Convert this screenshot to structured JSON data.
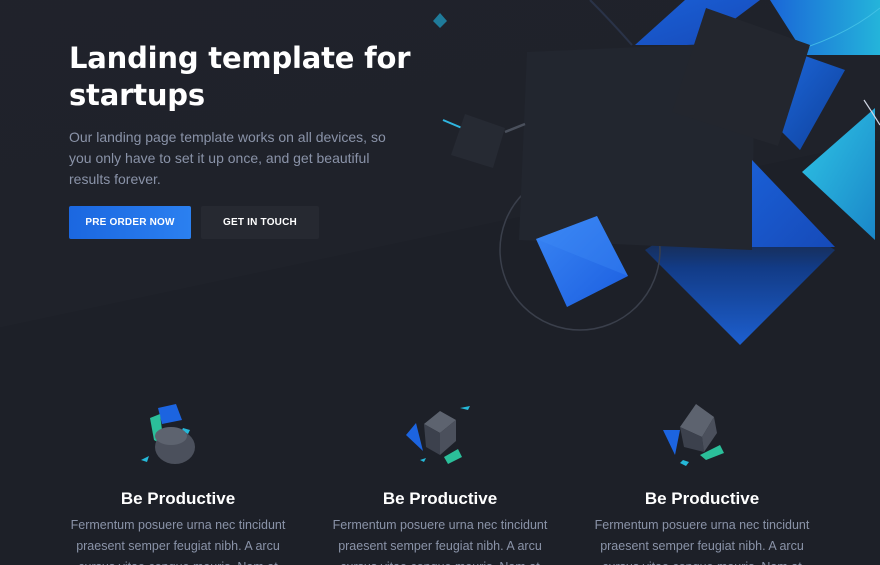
{
  "hero": {
    "title": "Landing template for startups",
    "paragraph": "Our landing page template works on all devices, so you only have to set it up once, and get beautiful results forever.",
    "primary_button": "PRE ORDER NOW",
    "secondary_button": "GET IN TOUCH"
  },
  "features": [
    {
      "icon": "cylinder-cubes-icon",
      "title": "Be Productive",
      "text": "Fermentum posuere urna nec tincidunt praesent semper feugiat nibh. A arcu cursus vitae congue mauris. Nam at"
    },
    {
      "icon": "cube-icon",
      "title": "Be Productive",
      "text": "Fermentum posuere urna nec tincidunt praesent semper feugiat nibh. A arcu cursus vitae congue mauris. Nam at"
    },
    {
      "icon": "cube-tilted-icon",
      "title": "Be Productive",
      "text": "Fermentum posuere urna nec tincidunt praesent semper feugiat nibh. A arcu cursus vitae congue mauris. Nam at"
    }
  ],
  "colors": {
    "background": "#1d2028",
    "accent_blue": "#2b80f0",
    "accent_cyan": "#25b8d8",
    "accent_teal": "#2bbf9a",
    "text_muted": "#8a93a8"
  }
}
